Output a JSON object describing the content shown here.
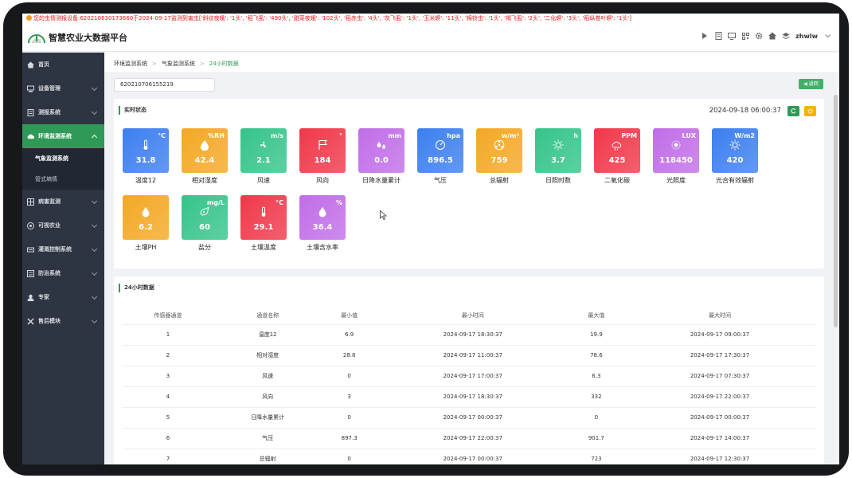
{
  "alert": "您的虫情测报设备:620210630173660于2024-09-17监测到害虫['斜纹夜蛾': '1头', '稻飞虱': '490头', '甜菜夜蛾': '102头', '稻赤虫': '4头', '灰飞虱': '1头', '玉米螟': '11头', '棉铃虫': '1头', '褐飞虱': '2头', '二化螟': '3头', '稻纵卷叶螟': '1头']",
  "app": {
    "title": "智慧农业大数据平台",
    "user": "zhwlw"
  },
  "sidebar": {
    "items": [
      {
        "label": "首页",
        "icon": "home-icon"
      },
      {
        "label": "设备管理",
        "icon": "device-icon"
      },
      {
        "label": "测报系统",
        "icon": "report-icon"
      },
      {
        "label": "环境监测系统",
        "icon": "cloud-icon"
      },
      {
        "label": "病害监测",
        "icon": "grid-icon"
      },
      {
        "label": "可视农业",
        "icon": "camera-icon"
      },
      {
        "label": "灌溉控制系统",
        "icon": "irrigation-icon"
      },
      {
        "label": "防治系统",
        "icon": "shield-icon"
      },
      {
        "label": "专家",
        "icon": "expert-icon"
      },
      {
        "label": "售后模块",
        "icon": "tools-icon"
      }
    ],
    "subs": [
      "气象监测系统",
      "管式墒情"
    ]
  },
  "breadcrumb": [
    "环境监测系统",
    "气象监测系统",
    "24小时数据"
  ],
  "device": "620210706155219",
  "back_label": "返回",
  "realtime": {
    "title": "实时状态",
    "datetime": "2024-09-18 06:00:37",
    "tiles": [
      {
        "name": "温度12",
        "value": "31.8",
        "unit": "°C",
        "color": "#3d7ff0",
        "icon": "thermometer-icon"
      },
      {
        "name": "相对湿度",
        "value": "42.4",
        "unit": "%RH",
        "color": "#f4a825",
        "icon": "humidity-icon"
      },
      {
        "name": "风速",
        "value": "2.1",
        "unit": "m/s",
        "color": "#35c48a",
        "icon": "fan-icon"
      },
      {
        "name": "风向",
        "value": "184",
        "unit": "°",
        "color": "#f0384a",
        "icon": "flag-icon"
      },
      {
        "name": "日降水量累计",
        "value": "0.0",
        "unit": "mm",
        "color": "#c16ee8",
        "icon": "rain-icon"
      },
      {
        "name": "气压",
        "value": "896.5",
        "unit": "hpa",
        "color": "#3d7ff0",
        "icon": "gauge-icon"
      },
      {
        "name": "总辐射",
        "value": "759",
        "unit": "w/m²",
        "color": "#f4a825",
        "icon": "radiation-icon"
      },
      {
        "name": "日照时数",
        "value": "3.7",
        "unit": "h",
        "color": "#35c48a",
        "icon": "sun-icon"
      },
      {
        "name": "二氧化碳",
        "value": "425",
        "unit": "PPM",
        "color": "#f0384a",
        "icon": "co2-icon"
      },
      {
        "name": "光照度",
        "value": "118450",
        "unit": "LUX",
        "color": "#c16ee8",
        "icon": "light-icon"
      },
      {
        "name": "光合有效辐射",
        "value": "420",
        "unit": "W/m2",
        "color": "#3d7ff0",
        "icon": "sun-icon"
      },
      {
        "name": "土壤PH",
        "value": "6.2",
        "unit": "",
        "color": "#f4a825",
        "icon": "drop-icon"
      },
      {
        "name": "盐分",
        "value": "60",
        "unit": "mg/L",
        "color": "#35c48a",
        "icon": "salt-icon"
      },
      {
        "name": "土壤温度",
        "value": "29.1",
        "unit": "°C",
        "color": "#f0384a",
        "icon": "thermometer-icon"
      },
      {
        "name": "土壤含水率",
        "value": "36.4",
        "unit": "%",
        "color": "#c16ee8",
        "icon": "drop-icon"
      }
    ]
  },
  "table": {
    "title": "24小时数据",
    "headers": [
      "传感器通道",
      "通道名称",
      "最小值",
      "最小时间",
      "最大值",
      "最大时间"
    ],
    "rows": [
      [
        "1",
        "温度12",
        "6.9",
        "2024-09-17 18:30:37",
        "19.9",
        "2024-09-17 09:00:37"
      ],
      [
        "2",
        "相对湿度",
        "28.8",
        "2024-09-17 11:00:37",
        "78.6",
        "2024-09-17 17:30:37"
      ],
      [
        "3",
        "风速",
        "0",
        "2024-09-17 17:00:37",
        "6.3",
        "2024-09-17 07:30:37"
      ],
      [
        "4",
        "风向",
        "3",
        "2024-09-17 18:30:37",
        "332",
        "2024-09-17 22:00:37"
      ],
      [
        "5",
        "日降水量累计",
        "0",
        "2024-09-17 00:00:37",
        "0",
        "2024-09-17 00:00:37"
      ],
      [
        "6",
        "气压",
        "897.3",
        "2024-09-17 22:00:37",
        "901.7",
        "2024-09-17 14:00:37"
      ],
      [
        "7",
        "总辐射",
        "0",
        "2024-09-17 00:00:37",
        "723",
        "2024-09-17 12:30:37"
      ]
    ]
  },
  "colors": {
    "accent": "#2f9a58",
    "sidebar": "#2d3442",
    "alert": "#e02020"
  }
}
